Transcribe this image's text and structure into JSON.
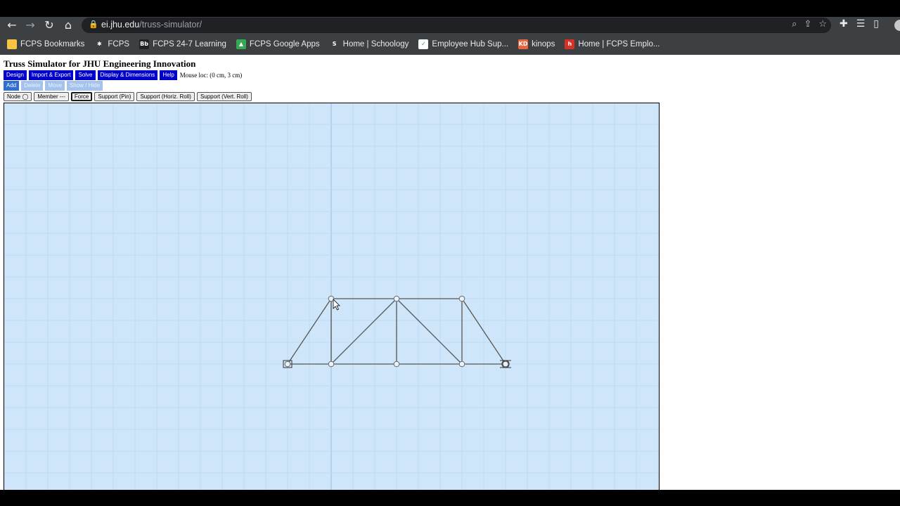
{
  "browser": {
    "url_host": "ei.jhu.edu",
    "url_path": "/truss-simulator/",
    "icons": {
      "back": "back-arrow-icon",
      "forward": "forward-arrow-icon",
      "reload": "reload-icon",
      "home": "home-icon",
      "lock": "lock-icon"
    },
    "bookmarks": [
      {
        "label": "FCPS Bookmarks",
        "icon": "folder-icon",
        "color": "#f6c343",
        "glyph": ""
      },
      {
        "label": "FCPS",
        "icon": "fcps-icon",
        "color": "#3c4043",
        "glyph": "✱"
      },
      {
        "label": "FCPS 24-7 Learning",
        "icon": "blackboard-icon",
        "color": "#222222",
        "glyph": "Bb"
      },
      {
        "label": "FCPS Google Apps",
        "icon": "drive-icon",
        "color": "#34a853",
        "glyph": "▲"
      },
      {
        "label": "Home | Schoology",
        "icon": "schoology-icon",
        "color": "#3c4043",
        "glyph": "S"
      },
      {
        "label": "Employee Hub Sup...",
        "icon": "employee-hub-icon",
        "color": "#ffffff",
        "glyph": "✓"
      },
      {
        "label": "kinops",
        "icon": "kinops-icon",
        "color": "#e8663d",
        "glyph": "KD"
      },
      {
        "label": "Home | FCPS Emplo...",
        "icon": "fcps-employee-icon",
        "color": "#d93025",
        "glyph": "h"
      }
    ]
  },
  "app": {
    "title": "Truss Simulator for JHU Engineering Innovation",
    "menu": [
      "Design",
      "Import & Export",
      "Solve",
      "Display & Dimensions",
      "Help"
    ],
    "mouse_loc": "Mouse loc: (0 cm, 3 cm)",
    "modes": [
      {
        "label": "Add",
        "active": true
      },
      {
        "label": "Delete",
        "active": false
      },
      {
        "label": "Move",
        "active": false
      },
      {
        "label": "Show / Hide",
        "active": false
      }
    ],
    "tools": [
      {
        "label": "Node ◯",
        "selected": false
      },
      {
        "label": "Member ---",
        "selected": false
      },
      {
        "label": "Force",
        "selected": true
      },
      {
        "label": "Support (Pin)",
        "selected": false
      },
      {
        "label": "Support (Horiz. Roll)",
        "selected": false
      },
      {
        "label": "Support (Vert. Roll)",
        "selected": false
      }
    ]
  },
  "truss": {
    "nodes": [
      {
        "id": "A",
        "x": 0,
        "y": 0,
        "support": "pin"
      },
      {
        "id": "B",
        "x": 2,
        "y": 0
      },
      {
        "id": "C",
        "x": 5,
        "y": 0
      },
      {
        "id": "D",
        "x": 8,
        "y": 0
      },
      {
        "id": "E",
        "x": 10,
        "y": 0,
        "support": "roller"
      },
      {
        "id": "F",
        "x": 2,
        "y": 3
      },
      {
        "id": "G",
        "x": 5,
        "y": 3
      },
      {
        "id": "H",
        "x": 8,
        "y": 3
      }
    ],
    "members": [
      [
        "A",
        "B"
      ],
      [
        "B",
        "C"
      ],
      [
        "C",
        "D"
      ],
      [
        "D",
        "E"
      ],
      [
        "F",
        "G"
      ],
      [
        "G",
        "H"
      ],
      [
        "A",
        "F"
      ],
      [
        "B",
        "F"
      ],
      [
        "B",
        "G"
      ],
      [
        "C",
        "G"
      ],
      [
        "G",
        "D"
      ],
      [
        "H",
        "D"
      ],
      [
        "H",
        "E"
      ]
    ],
    "colors": {
      "background": "#cfe6fa",
      "grid": "#b8d6f0",
      "axis": "#a9cbe9",
      "member": "#555555"
    }
  }
}
